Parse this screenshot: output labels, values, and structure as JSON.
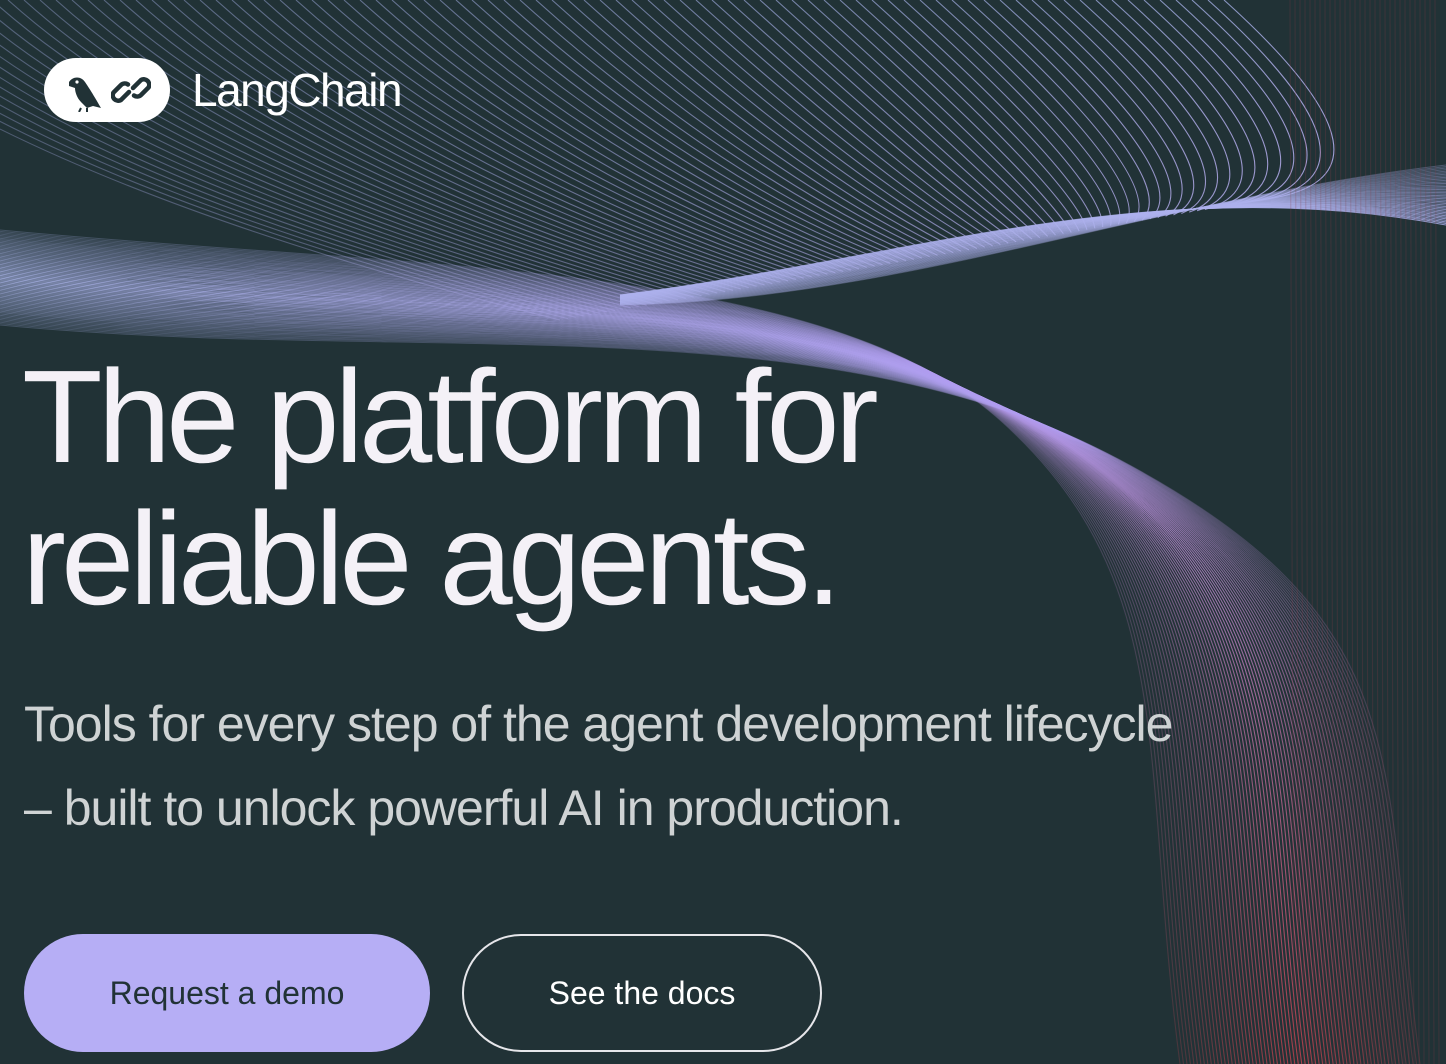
{
  "brand": {
    "name": "LangChain",
    "logo_icon": "parrot-and-chain-icon"
  },
  "hero": {
    "title_line1": "The platform for",
    "title_line2": "reliable agents.",
    "subtitle_line1": "Tools for every step of the agent development lifecycle",
    "subtitle_line2": "– built to unlock powerful AI in production."
  },
  "buttons": {
    "demo_label": "Request a demo",
    "docs_label": "See the docs"
  },
  "colors": {
    "background": "#213236",
    "accent": "#b6aef5",
    "text": "#f4f1f7",
    "wave_lavender": "#a9a3ef",
    "wave_red": "#c2404c"
  }
}
